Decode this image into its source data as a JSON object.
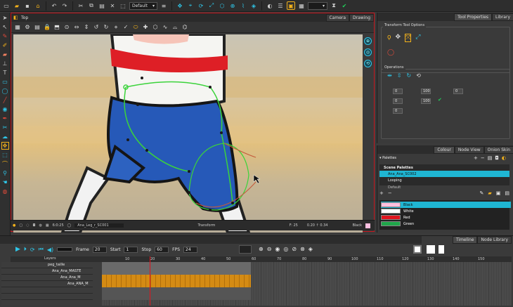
{
  "toolbar": {
    "view_dropdown": "Default"
  },
  "view_panel": {
    "title": "Top",
    "tabs": [
      "Camera",
      "Drawing"
    ]
  },
  "status": {
    "drawing_name": "Ana_Leg_r_SC001",
    "zoom": "Transform",
    "frame": "F: 25",
    "coords": "0.20 ↑ 0.34",
    "frame_counter": "6:0:25",
    "mode": "Black"
  },
  "tool_panel": {
    "tabs": [
      "Tool Properties",
      "Library"
    ],
    "transform_options_label": "Transform Tool Options",
    "operations_label": "Operations",
    "fields": [
      "0",
      "0",
      "0",
      "100",
      "100",
      "0"
    ]
  },
  "colour_panel": {
    "tabs": [
      "Colour",
      "Node View",
      "Onion Skin"
    ],
    "palettes_header": "Palettes",
    "scene_palettes_label": "Scene Palettes",
    "palettes": [
      "Ana_Ana_SC002",
      "Looping",
      "Default"
    ],
    "swatches": [
      {
        "name": "Black",
        "color": "#ffc0e0"
      },
      {
        "name": "White",
        "color": "#ffffff"
      },
      {
        "name": "Red",
        "color": "#e0141e"
      },
      {
        "name": "Green",
        "color": "#1fa64a"
      }
    ]
  },
  "timeline": {
    "tabs": [
      "Timeline",
      "Node Library"
    ],
    "frame_label": "Frame",
    "frame_value": "20",
    "start_label": "Start",
    "start_value": "1",
    "stop_label": "Stop",
    "stop_value": "60",
    "fps_label": "FPS",
    "fps_value": "24",
    "layers_header": "Layers",
    "layers": [
      "peg_taille",
      "Ana_Ana_MASTE",
      "Ana_Ana_M",
      "Ana_ANA_M",
      "",
      ""
    ],
    "ruler": [
      "10",
      "20",
      "30",
      "40",
      "50",
      "60",
      "70",
      "80",
      "90",
      "100",
      "110",
      "120",
      "130",
      "140",
      "150"
    ]
  }
}
